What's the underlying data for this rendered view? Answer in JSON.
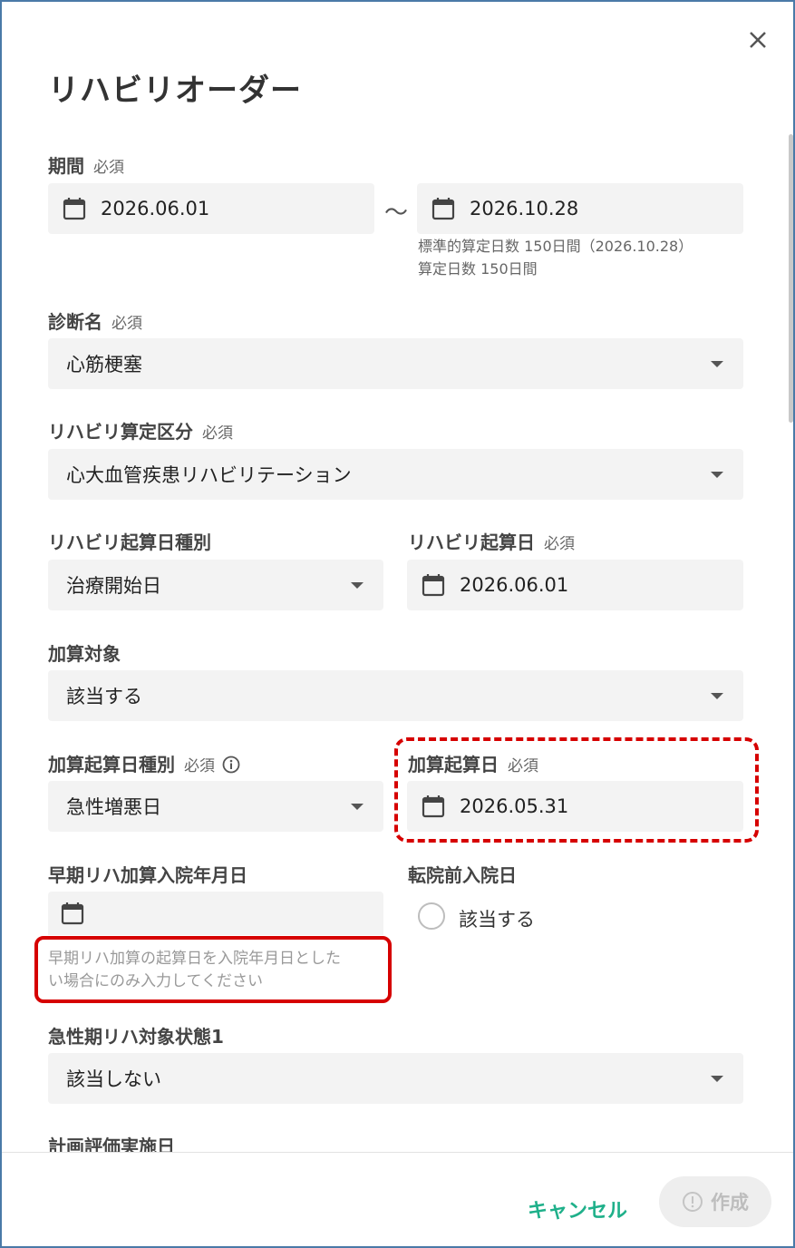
{
  "dialog": {
    "title": "リハビリオーダー",
    "close_icon": "close-icon"
  },
  "period": {
    "label": "期間",
    "required": "必須",
    "start": "2026.06.01",
    "separator": "〜",
    "end": "2026.10.28",
    "helper_line1": "標準的算定日数 150日間（2026.10.28）",
    "helper_line2": "算定日数 150日間"
  },
  "diagnosis": {
    "label": "診断名",
    "required": "必須",
    "value": "心筋梗塞"
  },
  "rehab_category": {
    "label": "リハビリ算定区分",
    "required": "必須",
    "value": "心大血管疾患リハビリテーション"
  },
  "rehab_start_type": {
    "label": "リハビリ起算日種別",
    "value": "治療開始日"
  },
  "rehab_start_date": {
    "label": "リハビリ起算日",
    "required": "必須",
    "value": "2026.06.01"
  },
  "addition_target": {
    "label": "加算対象",
    "value": "該当する"
  },
  "addition_start_type": {
    "label": "加算起算日種別",
    "required": "必須",
    "info_icon": "info-icon",
    "value": "急性増悪日"
  },
  "addition_start_date": {
    "label": "加算起算日",
    "required": "必須",
    "value": "2026.05.31"
  },
  "early_rehab_admission": {
    "label": "早期リハ加算入院年月日",
    "value": "",
    "hint_line1": "早期リハ加算の起算日を入院年月日とした",
    "hint_line2": "い場合にのみ入力してください"
  },
  "pre_transfer_admission": {
    "label": "転院前入院日",
    "option_label": "該当する"
  },
  "acute_rehab_state1": {
    "label": "急性期リハ対象状態1",
    "value": "該当しない"
  },
  "plan_eval_date": {
    "label": "計画評価実施日"
  },
  "footer": {
    "cancel_label": "キャンセル",
    "create_label": "作成"
  },
  "colors": {
    "accent": "#1fb08a",
    "highlight": "#d60000",
    "field_bg": "#f3f3f3",
    "border": "#4a7aa8"
  }
}
